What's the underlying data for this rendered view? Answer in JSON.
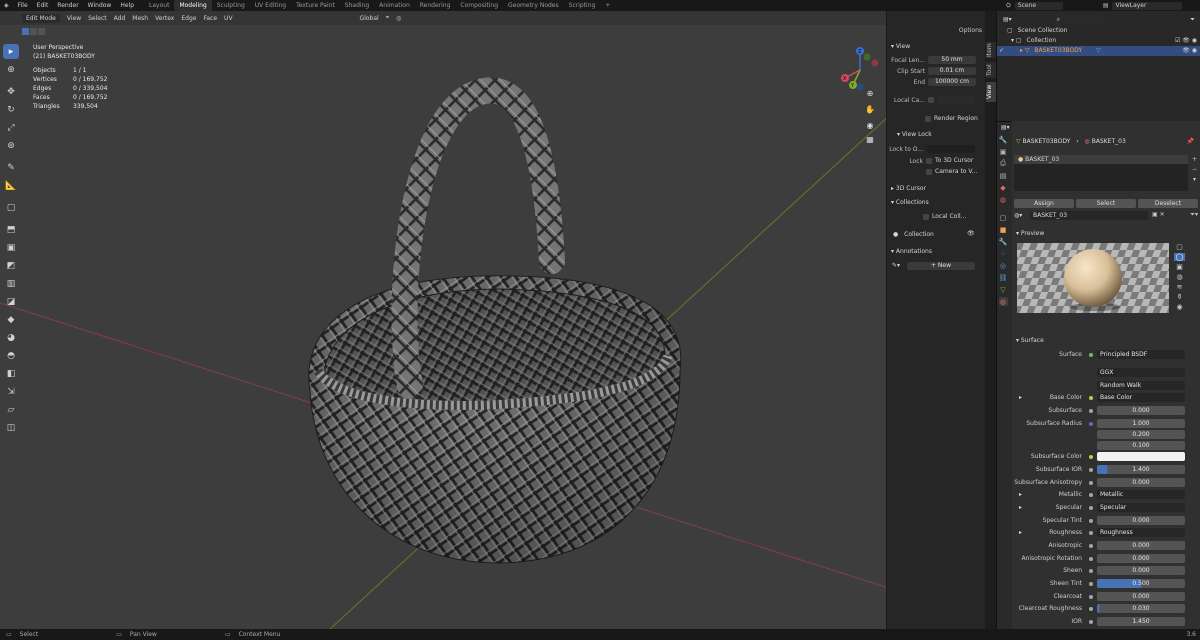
{
  "menu": [
    "File",
    "Edit",
    "Render",
    "Window",
    "Help"
  ],
  "workspaces": [
    "Layout",
    "Modeling",
    "Sculpting",
    "UV Editing",
    "Texture Paint",
    "Shading",
    "Animation",
    "Rendering",
    "Compositing",
    "Geometry Nodes",
    "Scripting"
  ],
  "active_workspace": "Modeling",
  "scene_label": "Scene",
  "viewlayer_label": "ViewLayer",
  "viewport": {
    "mode": "Edit Mode",
    "menus": [
      "View",
      "Select",
      "Add",
      "Mesh",
      "Vertex",
      "Edge",
      "Face",
      "UV"
    ],
    "orientation": "Global",
    "perspective": "User Perspective",
    "object_name": "(21) BASKET03BODY",
    "stats": [
      {
        "label": "Objects",
        "value": "1 / 1"
      },
      {
        "label": "Vertices",
        "value": "0 / 169,752"
      },
      {
        "label": "Edges",
        "value": "0 / 339,504"
      },
      {
        "label": "Faces",
        "value": "0 / 169,752"
      },
      {
        "label": "Triangles",
        "value": "339,504"
      }
    ],
    "gizmo": {
      "x": "X",
      "y": "Y",
      "z": "Z"
    }
  },
  "npanel": {
    "options": "Options",
    "view_header": "View",
    "focal_label": "Focal Len...",
    "focal_value": "50 mm",
    "clip_start_label": "Clip Start",
    "clip_start_value": "0.01 cm",
    "end_label": "End",
    "end_value": "100000 cm",
    "local_camera_label": "Local Ca...",
    "render_region": "Render Region",
    "view_lock_header": "View Lock",
    "lock_object_label": "Lock to O...",
    "lock_label": "Lock",
    "to_3d_cursor": "To 3D Cursor",
    "camera_to_view": "Camera to V...",
    "cursor_header": "3D Cursor",
    "collections_header": "Collections",
    "local_collections": "Local Coll...",
    "collection_item": "Collection",
    "annotations_header": "Annotations",
    "new_button": "New",
    "tabs": [
      "Item",
      "Tool",
      "View"
    ]
  },
  "outliner": {
    "scene_collection": "Scene Collection",
    "collection": "Collection",
    "object": "BASKET03BODY"
  },
  "properties": {
    "breadcrumb_object": "BASKET03BODY",
    "breadcrumb_material": "BASKET_03",
    "slot": "BASKET_03",
    "assign": "Assign",
    "select": "Select",
    "deselect": "Deselect",
    "material_name": "BASKET_03",
    "preview_header": "Preview",
    "surface_header": "Surface",
    "rows": [
      {
        "label": "Surface",
        "value": "Principled BSDF",
        "kind": "link"
      },
      {
        "label": "",
        "value": "GGX",
        "kind": "enum"
      },
      {
        "label": "",
        "value": "Random Walk",
        "kind": "enum"
      },
      {
        "label": "Base Color",
        "value": "Base Color",
        "kind": "link"
      },
      {
        "label": "Subsurface",
        "value": "0.000",
        "kind": "num"
      },
      {
        "label": "Subsurface Radius",
        "value": "1.000",
        "kind": "num"
      },
      {
        "label": "",
        "value": "0.200",
        "kind": "num"
      },
      {
        "label": "",
        "value": "0.100",
        "kind": "num"
      },
      {
        "label": "Subsurface Color",
        "value": "",
        "kind": "color"
      },
      {
        "label": "Subsurface IOR",
        "value": "1.400",
        "kind": "num"
      },
      {
        "label": "Subsurface Anisotropy",
        "value": "0.000",
        "kind": "num"
      },
      {
        "label": "Metallic",
        "value": "Metallic",
        "kind": "link"
      },
      {
        "label": "Specular",
        "value": "Specular",
        "kind": "link"
      },
      {
        "label": "Specular Tint",
        "value": "0.000",
        "kind": "num"
      },
      {
        "label": "Roughness",
        "value": "Roughness",
        "kind": "link"
      },
      {
        "label": "Anisotropic",
        "value": "0.000",
        "kind": "num"
      },
      {
        "label": "Anisotropic Rotation",
        "value": "0.000",
        "kind": "num"
      },
      {
        "label": "Sheen",
        "value": "0.000",
        "kind": "num"
      },
      {
        "label": "Sheen Tint",
        "value": "0.500",
        "kind": "num"
      },
      {
        "label": "Clearcoat",
        "value": "0.000",
        "kind": "num"
      },
      {
        "label": "Clearcoat Roughness",
        "value": "0.030",
        "kind": "num"
      },
      {
        "label": "IOR",
        "value": "1.450",
        "kind": "num"
      }
    ]
  },
  "statusbar": {
    "select": "Select",
    "pan_view": "Pan View",
    "context_menu": "Context Menu",
    "version": "3.6"
  },
  "colors": {
    "accent": "#4772b3",
    "viewport_bg": "#3d3d3d",
    "axis_x": "#c94050",
    "axis_y": "#7fad2c"
  }
}
